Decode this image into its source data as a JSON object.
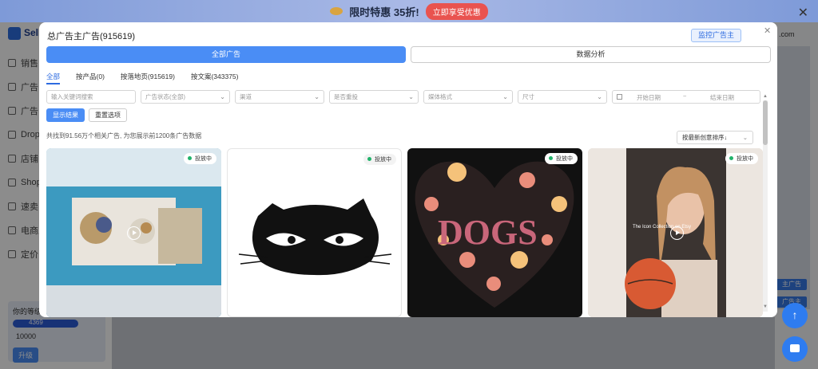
{
  "promo": {
    "text": "限时特惠 35折!",
    "button": "立即享受优惠"
  },
  "background": {
    "logo": "Sell",
    "menu": [
      "销售",
      "广告",
      "广告",
      "Drops",
      "店铺",
      "Shopi Aliexp",
      "速卖",
      "电商工",
      "定价"
    ],
    "level_label": "你的等级",
    "level_current": "4369",
    "level_max": "10000",
    "upgrade": "升级",
    "right_buttons": [
      "主广告",
      "广告主"
    ],
    "top_right": ".com"
  },
  "modal": {
    "title": "总广告主广告(915619)",
    "monitor_button": "监控广告主",
    "main_tab": "全部广告",
    "alt_tab": "数据分析",
    "subtabs": [
      "全部",
      "按产品(0)",
      "按落地页(915619)",
      "按文案(343375)"
    ],
    "filters": {
      "keyword_placeholder": "输入关键词搜索",
      "status": "广告状态(全部)",
      "channel": "渠道",
      "reposted": "是否重投",
      "media": "媒体格式",
      "size": "尺寸",
      "date_start": "开始日期",
      "date_sep": "~",
      "date_end": "结束日期"
    },
    "show_button": "显示结果",
    "reset_button": "重置选项",
    "found_text": "共找到91.56万个相关广告, 为您展示前1200条广告数据",
    "sort": "按最新创意排序↓",
    "cards": [
      {
        "status": "投放中"
      },
      {
        "status": "投放中"
      },
      {
        "status": "投放中",
        "image_text": "DOGS"
      },
      {
        "status": "投放中",
        "image_text": "The Icon Collection on Etsy"
      }
    ]
  }
}
